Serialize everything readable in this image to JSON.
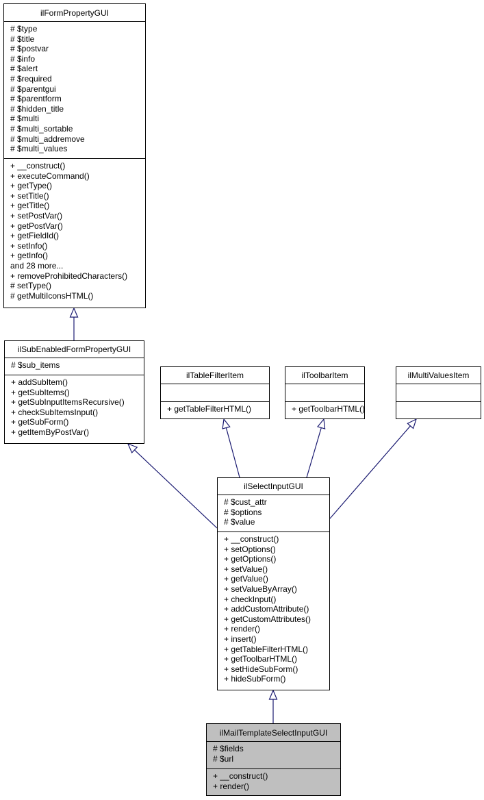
{
  "diagram": {
    "edge_color": "#191970",
    "classes": {
      "form_property": {
        "name": "ilFormPropertyGUI",
        "attributes": [
          "# $type",
          "# $title",
          "# $postvar",
          "# $info",
          "# $alert",
          "# $required",
          "# $parentgui",
          "# $parentform",
          "# $hidden_title",
          "# $multi",
          "# $multi_sortable",
          "# $multi_addremove",
          "# $multi_values"
        ],
        "methods": [
          "+ __construct()",
          "+ executeCommand()",
          "+ getType()",
          "+ setTitle()",
          "+ getTitle()",
          "+ setPostVar()",
          "+ getPostVar()",
          "+ getFieldId()",
          "+ setInfo()",
          "+ getInfo()",
          "and 28 more...",
          "+ removeProhibitedCharacters()",
          "# setType()",
          "# getMultiIconsHTML()"
        ]
      },
      "sub_enabled": {
        "name": "ilSubEnabledFormPropertyGUI",
        "attributes": [
          "# $sub_items"
        ],
        "methods": [
          "+ addSubItem()",
          "+ getSubItems()",
          "+ getSubInputItemsRecursive()",
          "+ checkSubItemsInput()",
          "+ getSubForm()",
          "+ getItemByPostVar()"
        ]
      },
      "table_filter": {
        "name": "ilTableFilterItem",
        "attributes": [],
        "methods": [
          "+ getTableFilterHTML()"
        ]
      },
      "toolbar": {
        "name": "ilToolbarItem",
        "attributes": [],
        "methods": [
          "+ getToolbarHTML()"
        ]
      },
      "multi_values": {
        "name": "ilMultiValuesItem",
        "attributes": [],
        "methods": []
      },
      "select_input": {
        "name": "ilSelectInputGUI",
        "attributes": [
          "# $cust_attr",
          "# $options",
          "# $value"
        ],
        "methods": [
          "+ __construct()",
          "+ setOptions()",
          "+ getOptions()",
          "+ setValue()",
          "+ getValue()",
          "+ setValueByArray()",
          "+ checkInput()",
          "+ addCustomAttribute()",
          "+ getCustomAttributes()",
          "+ render()",
          "+ insert()",
          "+ getTableFilterHTML()",
          "+ getToolbarHTML()",
          "+ setHideSubForm()",
          "+ hideSubForm()"
        ]
      },
      "mail_template": {
        "name": "ilMailTemplateSelectInputGUI",
        "attributes": [
          "# $fields",
          "# $url"
        ],
        "methods": [
          "+ __construct()",
          "+ render()"
        ],
        "highlighted": true
      }
    },
    "edges": [
      {
        "from": "sub_enabled",
        "to": "form_property",
        "type": "inheritance"
      },
      {
        "from": "select_input",
        "to": "sub_enabled",
        "type": "inheritance"
      },
      {
        "from": "select_input",
        "to": "table_filter",
        "type": "inheritance"
      },
      {
        "from": "select_input",
        "to": "toolbar",
        "type": "inheritance"
      },
      {
        "from": "select_input",
        "to": "multi_values",
        "type": "inheritance"
      },
      {
        "from": "mail_template",
        "to": "select_input",
        "type": "inheritance"
      }
    ]
  }
}
